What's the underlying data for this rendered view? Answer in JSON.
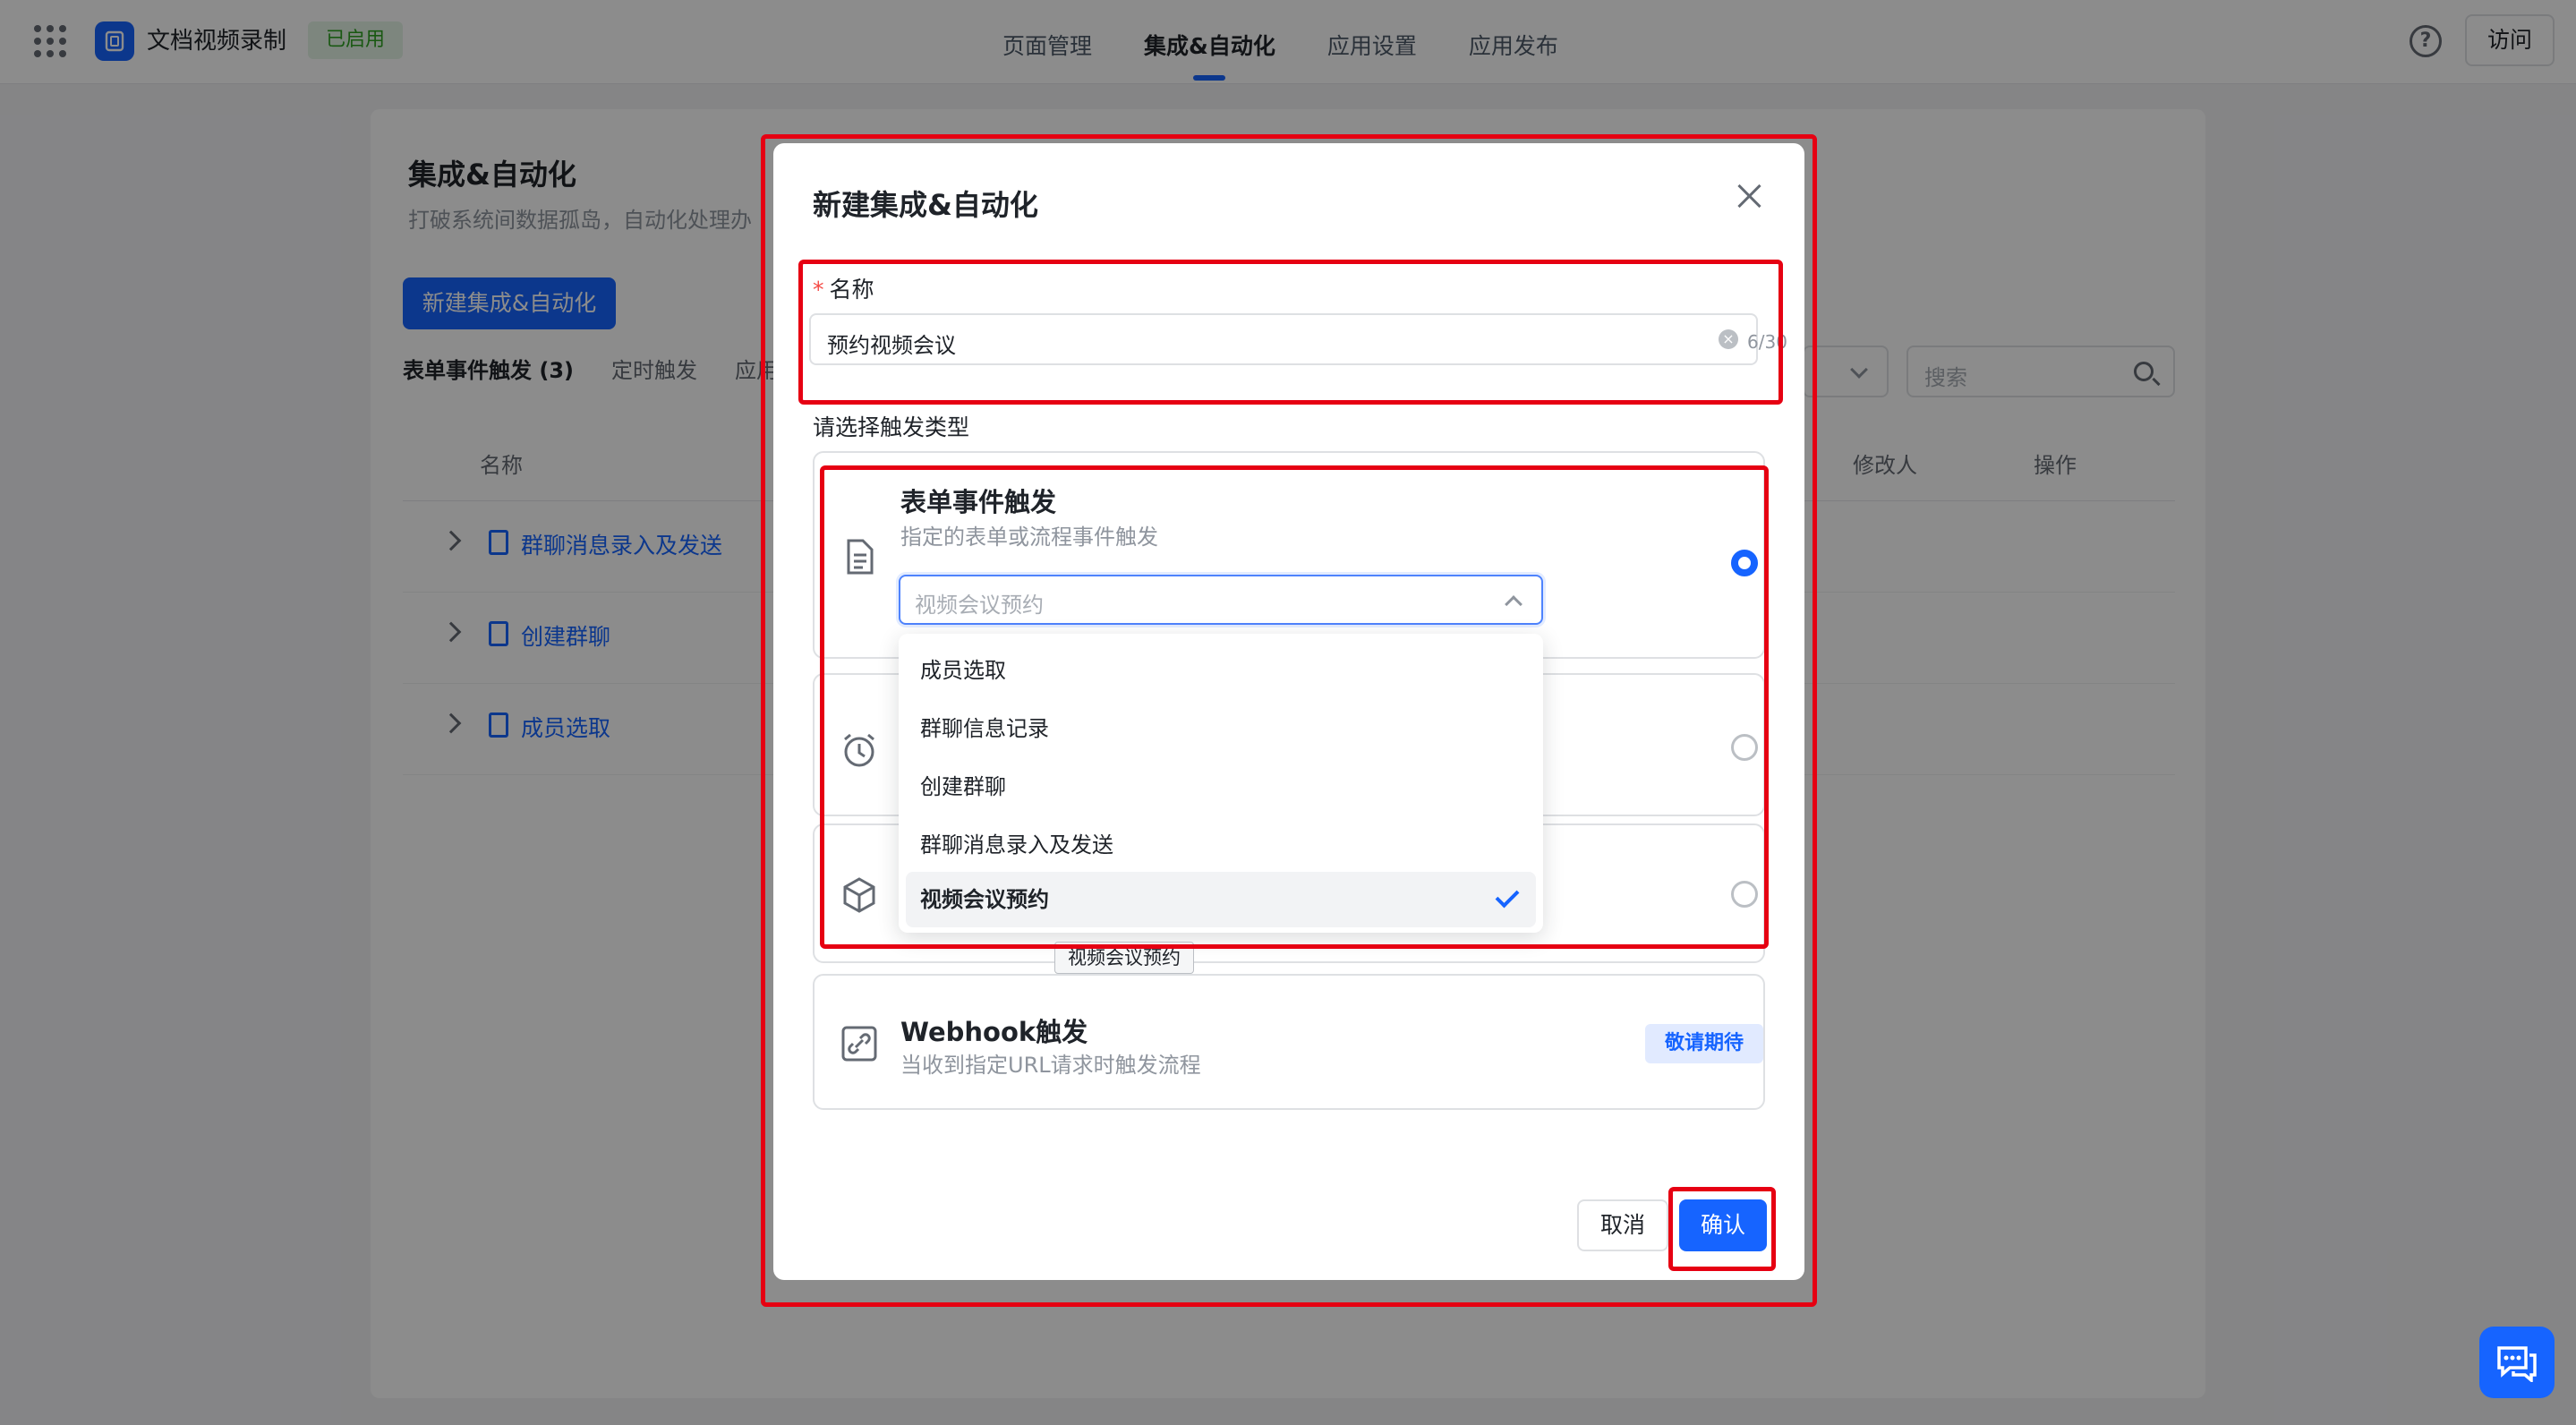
{
  "topbar": {
    "app_name": "文档视频录制",
    "status_tag": "已启用",
    "nav": [
      "页面管理",
      "集成&自动化",
      "应用设置",
      "应用发布"
    ],
    "active_nav": 1,
    "help_glyph": "?",
    "visit_label": "访问"
  },
  "panel": {
    "title": "集成&自动化",
    "description": "打破系统间数据孤岛，自动化处理办",
    "new_button": "新建集成&自动化",
    "tabs": [
      "表单事件触发 (3)",
      "定时触发",
      "应用"
    ],
    "search_placeholder": "搜索",
    "columns": [
      "名称",
      "修改人",
      "操作"
    ],
    "rows": [
      "群聊消息录入及发送",
      "创建群聊",
      "成员选取"
    ]
  },
  "modal": {
    "title": "新建集成&自动化",
    "name_label": "名称",
    "name_required_mark": "*",
    "name_value": "预约视频会议",
    "name_count": "6/30",
    "trigger_label": "请选择触发类型",
    "form_trigger": {
      "title": "表单事件触发",
      "desc": "指定的表单或流程事件触发",
      "select_placeholder": "视频会议预约"
    },
    "dropdown_options": [
      "成员选取",
      "群聊信息记录",
      "创建群聊",
      "群聊消息录入及发送",
      "视频会议预约"
    ],
    "selected_option": "视频会议预约",
    "tooltip": "视频会议预约",
    "webhook": {
      "title": "Webhook触发",
      "desc": "当收到指定URL请求时触发流程",
      "tag": "敬请期待"
    },
    "cancel_label": "取消",
    "confirm_label": "确认"
  },
  "colors": {
    "primary": "#1664ff",
    "annotation_red": "#e60012",
    "enabled_green": "#2ea121"
  }
}
